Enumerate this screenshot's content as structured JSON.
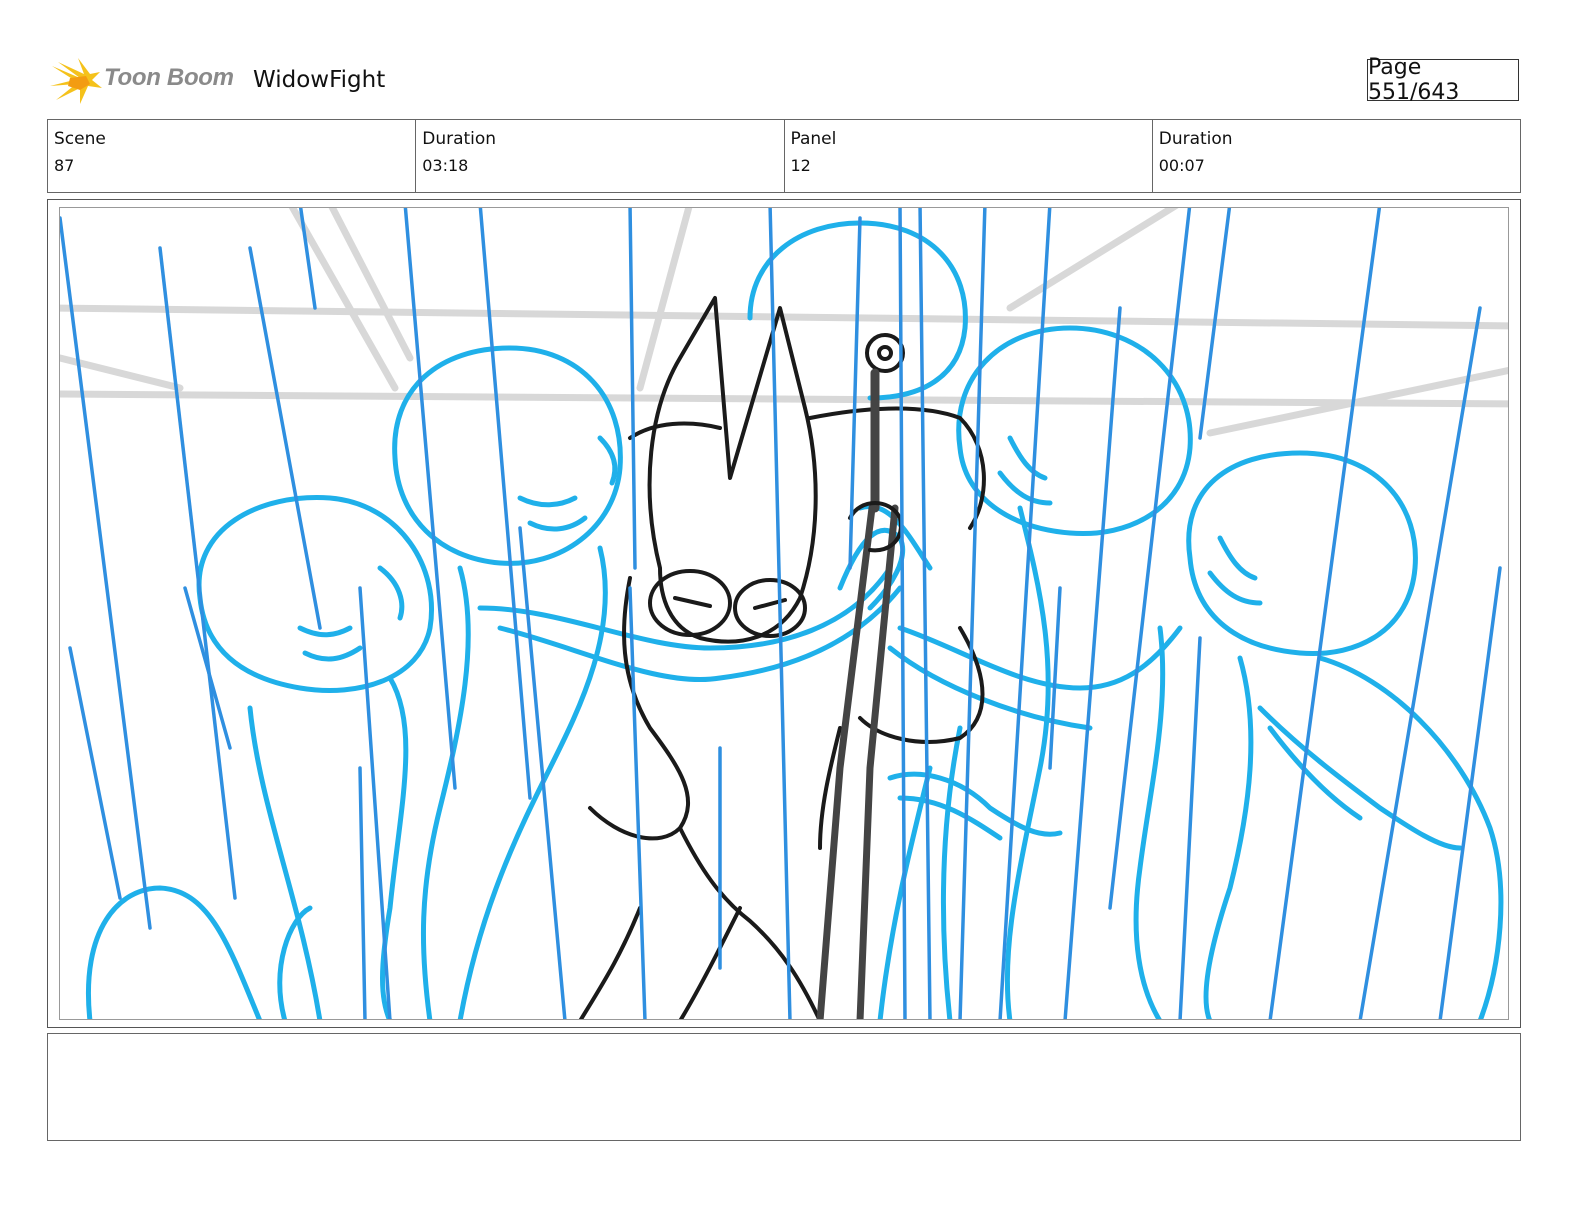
{
  "header": {
    "logo_name": "Toon Boom",
    "project_title": "WidowFight",
    "page_label": "Page 551/643"
  },
  "info": {
    "scene_label": "Scene",
    "scene_value": "87",
    "scene_duration_label": "Duration",
    "scene_duration_value": "03:18",
    "panel_label": "Panel",
    "panel_value": "12",
    "panel_duration_label": "Duration",
    "panel_duration_value": "00:07"
  },
  "notes": {
    "text": ""
  },
  "colors": {
    "sketch_blue": "#1fb0ea",
    "rain_blue": "#2f8fe0",
    "ink": "#1a1a1a",
    "background_gray": "#d8d8d8"
  }
}
